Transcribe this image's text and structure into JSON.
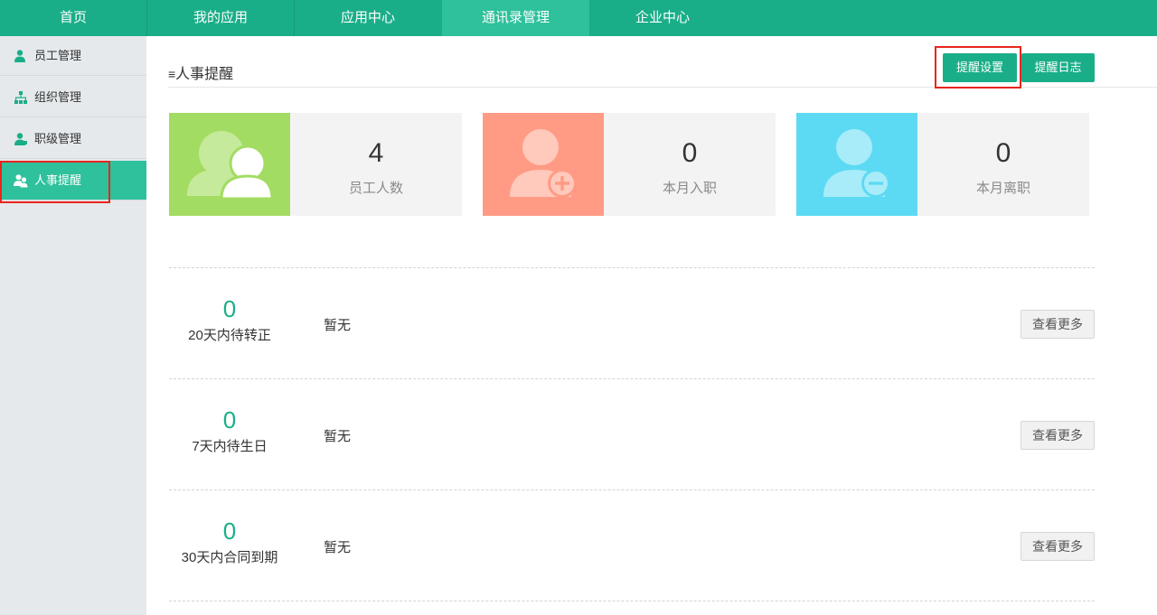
{
  "nav": {
    "tabs": [
      {
        "label": "首页"
      },
      {
        "label": "我的应用"
      },
      {
        "label": "应用中心"
      },
      {
        "label": "通讯录管理"
      },
      {
        "label": "企业中心"
      }
    ],
    "active_tab": "通讯录管理",
    "colors": {
      "bar": "#1aae88",
      "active": "#2ec19b"
    }
  },
  "sidebar": {
    "items": [
      {
        "label": "员工管理",
        "icon": "user-icon"
      },
      {
        "label": "组织管理",
        "icon": "org-tree-icon"
      },
      {
        "label": "职级管理",
        "icon": "user-level-icon"
      },
      {
        "label": "人事提醒",
        "icon": "users-icon"
      }
    ],
    "active_item": "人事提醒"
  },
  "header": {
    "title": "人事提醒",
    "title_icon": "list-icon",
    "settings_button": "提醒设置",
    "log_button": "提醒日志"
  },
  "stats": [
    {
      "value": "4",
      "label": "员工人数",
      "icon": "users-icon",
      "color": "#a3dc62"
    },
    {
      "value": "0",
      "label": "本月入职",
      "icon": "user-add-icon",
      "color": "#ff9b85"
    },
    {
      "value": "0",
      "label": "本月离职",
      "icon": "user-remove-icon",
      "color": "#5ddaf3"
    }
  ],
  "reminders": [
    {
      "count": "0",
      "label": "20天内待转正",
      "content": "暂无",
      "button": "查看更多"
    },
    {
      "count": "0",
      "label": "7天内待生日",
      "content": "暂无",
      "button": "查看更多"
    },
    {
      "count": "0",
      "label": "30天内合同到期",
      "content": "暂无",
      "button": "查看更多"
    }
  ]
}
